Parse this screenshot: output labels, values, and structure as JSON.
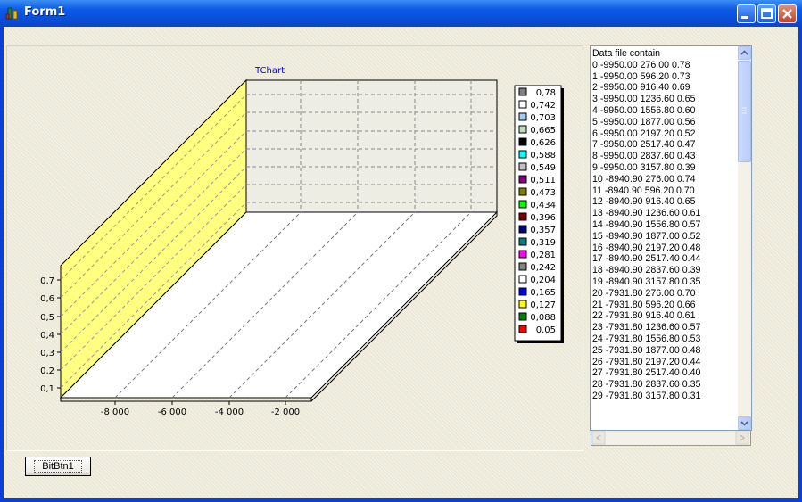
{
  "window": {
    "title": "Form1"
  },
  "chart": {
    "title": "TChart",
    "y_ticks": [
      "0,7",
      "0,6",
      "0,5",
      "0,4",
      "0,3",
      "0,2",
      "0,1"
    ],
    "x_ticks": [
      "-8 000",
      "-6 000",
      "-4 000",
      "-2 000"
    ],
    "legend": [
      {
        "label": "0,78",
        "color": "#808080"
      },
      {
        "label": "0,742",
        "color": "#FFFFFF"
      },
      {
        "label": "0,703",
        "color": "#A6CAF0"
      },
      {
        "label": "0,665",
        "color": "#C0DCC0"
      },
      {
        "label": "0,626",
        "color": "#000000"
      },
      {
        "label": "0,588",
        "color": "#00FFFF"
      },
      {
        "label": "0,549",
        "color": "#C0C0C0"
      },
      {
        "label": "0,511",
        "color": "#800080"
      },
      {
        "label": "0,473",
        "color": "#808000"
      },
      {
        "label": "0,434",
        "color": "#00FF00"
      },
      {
        "label": "0,396",
        "color": "#800000"
      },
      {
        "label": "0,357",
        "color": "#000080"
      },
      {
        "label": "0,319",
        "color": "#008080"
      },
      {
        "label": "0,281",
        "color": "#FF00FF"
      },
      {
        "label": "0,242",
        "color": "#808080"
      },
      {
        "label": "0,204",
        "color": "#FFFFFF"
      },
      {
        "label": "0,165",
        "color": "#0000FF"
      },
      {
        "label": "0,127",
        "color": "#FFFF00"
      },
      {
        "label": "0,088",
        "color": "#008000"
      },
      {
        "label": "0,05",
        "color": "#FF0000"
      }
    ],
    "wall_color": "#FFFF80"
  },
  "listbox": {
    "lines": [
      "Data file contain",
      "0 -9950.00 276.00 0.78",
      "1 -9950.00 596.20 0.73",
      "2 -9950.00 916.40 0.69",
      "3 -9950.00 1236.60 0.65",
      "4 -9950.00 1556.80 0.60",
      "5 -9950.00 1877.00 0.56",
      "6 -9950.00 2197.20 0.52",
      "7 -9950.00 2517.40 0.47",
      "8 -9950.00 2837.60 0.43",
      "9 -9950.00 3157.80 0.39",
      "10 -8940.90 276.00 0.74",
      "11 -8940.90 596.20 0.70",
      "12 -8940.90 916.40 0.65",
      "13 -8940.90 1236.60 0.61",
      "14 -8940.90 1556.80 0.57",
      "15 -8940.90 1877.00 0.52",
      "16 -8940.90 2197.20 0.48",
      "17 -8940.90 2517.40 0.44",
      "18 -8940.90 2837.60 0.39",
      "19 -8940.90 3157.80 0.35",
      "20 -7931.80 276.00 0.70",
      "21 -7931.80 596.20 0.66",
      "22 -7931.80 916.40 0.61",
      "23 -7931.80 1236.60 0.57",
      "24 -7931.80 1556.80 0.53",
      "25 -7931.80 1877.00 0.48",
      "26 -7931.80 2197.20 0.44",
      "27 -7931.80 2517.40 0.40",
      "28 -7931.80 2837.60 0.35",
      "29 -7931.80 3157.80 0.31"
    ]
  },
  "button": {
    "label": "BitBtn1"
  }
}
